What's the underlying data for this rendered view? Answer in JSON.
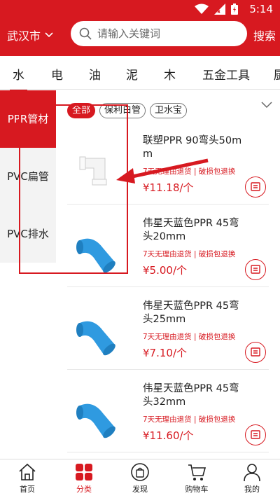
{
  "status": {
    "time": "5:14"
  },
  "header": {
    "city": "武汉市",
    "search_placeholder": "请输入关键词",
    "search_label": "搜索"
  },
  "categories": [
    "水",
    "电",
    "油",
    "泥",
    "木",
    "五金工具",
    "厨"
  ],
  "subcategories": [
    "PPR管材",
    "PVC扁管",
    "PVC排水"
  ],
  "filters": [
    "全部",
    "保利白管",
    "卫水宝"
  ],
  "products": [
    {
      "name": "联塑PPR 90弯头50mm",
      "promo": "7天无理由退货 | 破损包退换",
      "price": "¥11.18/个",
      "color": "#f4f4f4"
    },
    {
      "name": "伟星天蓝色PPR 45弯头20mm",
      "promo": "7天无理由退货 | 破损包退换",
      "price": "¥5.00/个",
      "color": "#2f9ae0"
    },
    {
      "name": "伟星天蓝色PPR 45弯头25mm",
      "promo": "7天无理由退货 | 破损包退换",
      "price": "¥7.10/个",
      "color": "#2f9ae0"
    },
    {
      "name": "伟星天蓝色PPR 45弯头32mm",
      "promo": "7天无理由退货 | 破损包退换",
      "price": "¥11.60/个",
      "color": "#2f9ae0"
    }
  ],
  "bottom_nav": [
    {
      "label": "首页",
      "icon": "home-icon"
    },
    {
      "label": "分类",
      "icon": "category-icon"
    },
    {
      "label": "发现",
      "icon": "discover-icon"
    },
    {
      "label": "购物车",
      "icon": "cart-icon"
    },
    {
      "label": "我的",
      "icon": "profile-icon"
    }
  ],
  "colors": {
    "accent": "#d71920"
  }
}
